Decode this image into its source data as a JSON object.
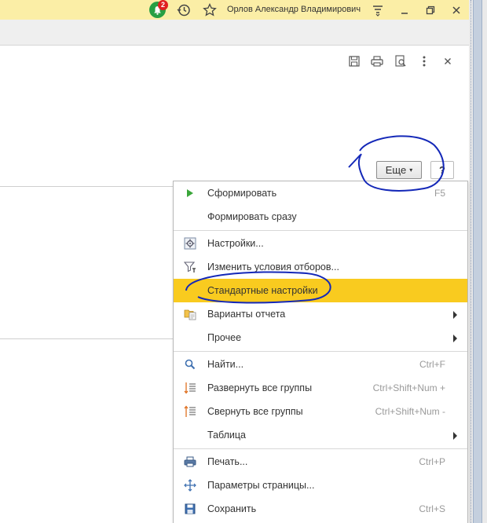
{
  "titlebar": {
    "user_name": "Орлов Александр Владимирович",
    "notification_count": "2",
    "bg_color": "#fbeea6"
  },
  "form": {
    "more_button_label": "Еще",
    "help_button_label": "?"
  },
  "menu": {
    "highlight_color": "#f9cb1f",
    "items": [
      {
        "label": "Сформировать",
        "shortcut": "F5",
        "icon": "play-icon"
      },
      {
        "label": "Формировать сразу",
        "shortcut": "",
        "icon": ""
      },
      {
        "label": "Настройки...",
        "shortcut": "",
        "icon": "settings-icon"
      },
      {
        "label": "Изменить условия отборов...",
        "shortcut": "",
        "icon": "filter-icon"
      },
      {
        "label": "Стандартные настройки",
        "shortcut": "",
        "icon": ""
      },
      {
        "label": "Варианты отчета",
        "shortcut": "",
        "icon": "report-variants-icon"
      },
      {
        "label": "Прочее",
        "shortcut": "",
        "icon": ""
      },
      {
        "label": "Найти...",
        "shortcut": "Ctrl+F",
        "icon": "search-icon"
      },
      {
        "label": "Развернуть все группы",
        "shortcut": "Ctrl+Shift+Num +",
        "icon": "expand-groups-icon"
      },
      {
        "label": "Свернуть все группы",
        "shortcut": "Ctrl+Shift+Num -",
        "icon": "collapse-groups-icon"
      },
      {
        "label": "Таблица",
        "shortcut": "",
        "icon": ""
      },
      {
        "label": "Печать...",
        "shortcut": "Ctrl+P",
        "icon": "print-icon"
      },
      {
        "label": "Параметры страницы...",
        "shortcut": "",
        "icon": "page-setup-icon"
      },
      {
        "label": "Сохранить",
        "shortcut": "Ctrl+S",
        "icon": "save-icon"
      }
    ]
  }
}
